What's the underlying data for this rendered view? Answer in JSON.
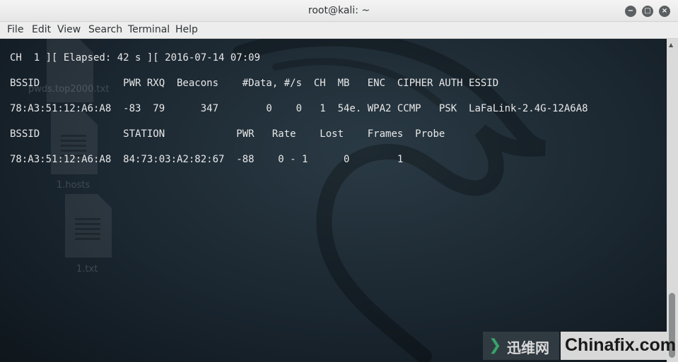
{
  "window": {
    "title": "root@kali: ~",
    "buttons": {
      "minimize": "−",
      "maximize": "□",
      "close": "×"
    }
  },
  "menu": [
    "File",
    "Edit",
    "View",
    "Search",
    "Terminal",
    "Help"
  ],
  "desktop_icons": [
    {
      "label": "pwds.top2000.txt"
    },
    {
      "label": "1.hosts"
    },
    {
      "label": "1.txt"
    }
  ],
  "terminal": {
    "lines": [
      "CH  1 ][ Elapsed: 42 s ][ 2016-07-14 07:09",
      "BSSID              PWR RXQ  Beacons    #Data, #/s  CH  MB   ENC  CIPHER AUTH ESSID",
      "78:A3:51:12:A6:A8  -83  79      347        0    0   1  54e. WPA2 CCMP   PSK  LaFaLink-2.4G-12A6A8",
      "BSSID              STATION            PWR   Rate    Lost    Frames  Probe",
      "78:A3:51:12:A6:A8  84:73:03:A2:82:67  -88    0 - 1      0        1"
    ]
  },
  "watermark": {
    "left": "迅维网",
    "right": "Chinafix.com"
  },
  "colors": {
    "titlebar": "#ececec",
    "terminal_bg": "#1d2a33",
    "text": "#e8e8e8",
    "watermark_green": "#39a36b"
  }
}
